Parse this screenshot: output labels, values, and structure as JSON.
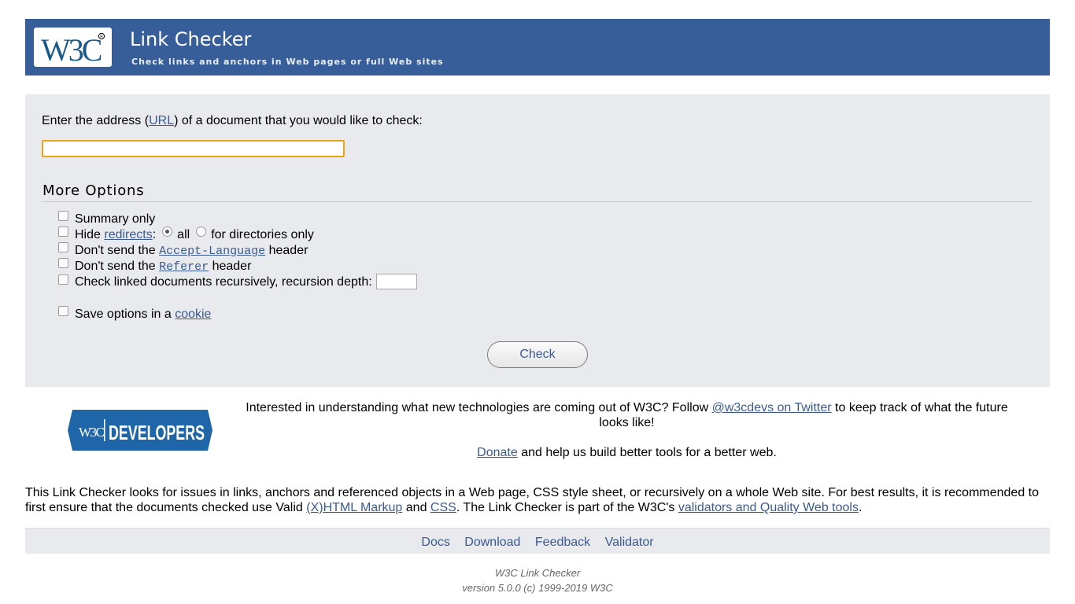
{
  "header": {
    "logo_text": "W3C",
    "title": "Link Checker",
    "subtitle": "Check links and anchors in Web pages or full Web sites"
  },
  "form": {
    "prompt_before": "Enter the address (",
    "prompt_link": "URL",
    "prompt_after": ") of a document that you would like to check:",
    "url_value": "",
    "more_options_title": "More Options",
    "options": {
      "summary_only": "Summary only",
      "hide_label": "Hide ",
      "hide_link": "redirects",
      "hide_colon": ":",
      "radio_all": "all",
      "radio_dirs": "for directories only",
      "accept_before": "Don't send the ",
      "accept_link": "Accept-Language",
      "accept_after": " header",
      "referer_before": "Don't send the ",
      "referer_link": "Referer",
      "referer_after": " header",
      "recursive_label": "Check linked documents recursively, recursion depth:",
      "recursion_depth": "",
      "save_before": "Save options in a ",
      "save_link": "cookie"
    },
    "check_button": "Check"
  },
  "promo": {
    "logo_text": "W3C DEVELOPERS",
    "text_before": "Interested in understanding what new technologies are coming out of W3C? Follow ",
    "twitter_link": "@w3cdevs on Twitter",
    "text_after": " to keep track of what the future looks like!",
    "donate_link": "Donate",
    "donate_after": " and help us build better tools for a better web."
  },
  "about": {
    "part1": "This Link Checker looks for issues in links, anchors and referenced objects in a Web page, CSS style sheet, or recursively on a whole Web site. For best results, it is recommended to first ensure that the documents checked use Valid ",
    "markup_link": "(X)HTML Markup",
    "and": " and ",
    "css_link": "CSS",
    "part2": ". The Link Checker is part of the W3C's ",
    "tools_link": "validators and Quality Web tools",
    "end": "."
  },
  "footer": {
    "nav": [
      "Docs",
      "Download",
      "Feedback",
      "Validator"
    ],
    "line1": "W3C Link Checker",
    "line2": "version 5.0.0 (c) 1999-2019 W3C"
  },
  "colors": {
    "banner": "#375e99",
    "panel": "#e9eaee",
    "link": "#3b5b8f",
    "input_focus": "#e8a617",
    "dev_logo": "#1e66a8"
  }
}
